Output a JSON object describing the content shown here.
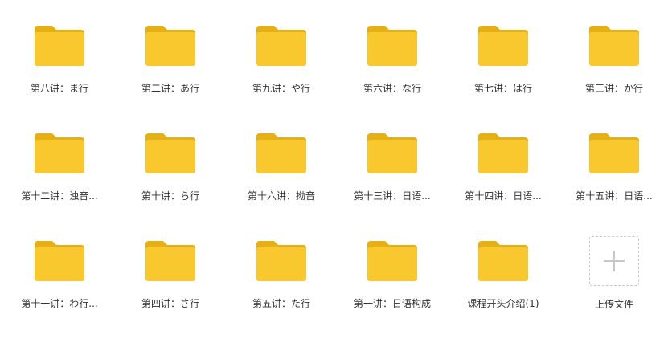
{
  "colors": {
    "folder_body": "#F8C82E",
    "folder_tab": "#E5AF16",
    "label_text": "#333333",
    "upload_border": "#C8C8C8",
    "upload_plus": "#C8C8C8"
  },
  "icons": {
    "folder": "folder-icon",
    "upload": "plus-icon"
  },
  "folders": [
    {
      "label": "第八讲：ま行"
    },
    {
      "label": "第二讲：あ行"
    },
    {
      "label": "第九讲：や行"
    },
    {
      "label": "第六讲：な行"
    },
    {
      "label": "第七讲：は行"
    },
    {
      "label": "第三讲：か行"
    },
    {
      "label": "第十二讲：浊音..."
    },
    {
      "label": "第十讲：ら行"
    },
    {
      "label": "第十六讲：拗音"
    },
    {
      "label": "第十三讲：日语..."
    },
    {
      "label": "第十四讲：日语..."
    },
    {
      "label": "第十五讲：日语..."
    },
    {
      "label": "第十一讲：わ行..."
    },
    {
      "label": "第四讲：さ行"
    },
    {
      "label": "第五讲：た行"
    },
    {
      "label": "第一讲：日语构成"
    },
    {
      "label": "课程开头介绍(1)"
    }
  ],
  "upload": {
    "label": "上传文件"
  }
}
